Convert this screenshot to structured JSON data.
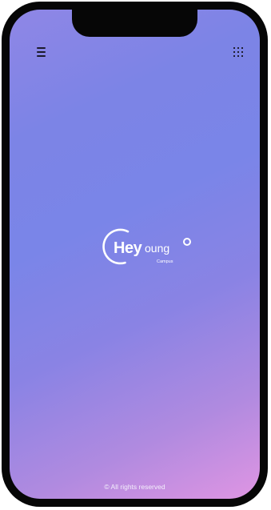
{
  "app": {
    "brand_prefix": "Hey",
    "brand_suffix": "oung",
    "brand_sub": "Campus",
    "footer": "© All rights reserved"
  },
  "icons": {
    "menu": "hamburger-menu-icon",
    "apps": "apps-grid-icon"
  },
  "colors": {
    "gradient_start": "#8f86e6",
    "gradient_mid": "#7a85e8",
    "gradient_end": "#df95e2",
    "icon": "#1b1b2b",
    "logo": "#ffffff",
    "frame": "#060606"
  }
}
